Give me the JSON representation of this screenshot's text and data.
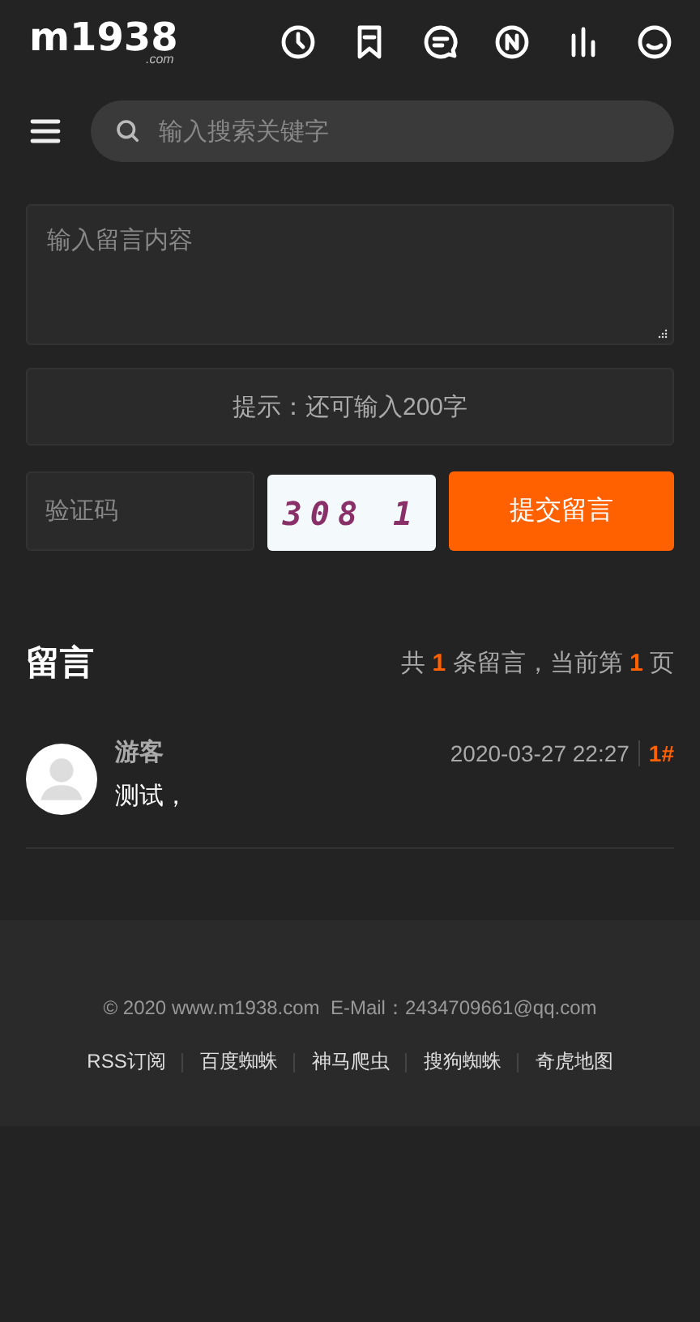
{
  "header": {
    "logo": "m1938",
    "logo_sub": ".com"
  },
  "search": {
    "placeholder": "输入搜索关键字"
  },
  "form": {
    "message_placeholder": "输入留言内容",
    "hint": "提示：还可输入200字",
    "captcha_placeholder": "验证码",
    "captcha_code": "308 1",
    "submit": "提交留言"
  },
  "comments_section": {
    "title": "留言",
    "summary": "共 **1** 条留言，当前第 **1** 页",
    "comments": [
      {
        "author": "游客",
        "time": "2020-03-27 22:27",
        "floor": "1#",
        "text": "测试，"
      }
    ]
  },
  "footer": {
    "copyright": "© 2020 www.m1938.com  E-Mail：2434709661@qq.com",
    "links": [
      "RSS订阅",
      "百度蜘蛛",
      "神马爬虫",
      "搜狗蜘蛛",
      "奇虎地图"
    ]
  }
}
